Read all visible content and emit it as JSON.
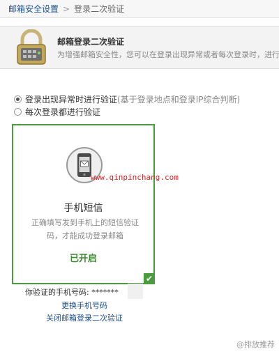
{
  "breadcrumb": {
    "parent": "邮箱安全设置",
    "separator": ">",
    "current": "登录二次验证"
  },
  "info": {
    "title": "邮箱登录二次验证",
    "description": "为增强邮箱安全性，您可以在登录出现异常或者每次登录时，进行额"
  },
  "options": {
    "opt1_label": "登录出现异常时进行验证",
    "opt1_hint": "(基于登录地点和登录IP综合判断)",
    "opt1_checked": true,
    "opt2_label": "每次登录都进行验证",
    "opt2_checked": false
  },
  "card": {
    "title": "手机短信",
    "description": "正确填写发到手机上的短信验证码，才能成功登录邮箱",
    "status": "已开启",
    "check": "✔",
    "icon": "phone-sms-icon"
  },
  "watermark": "www.qinpinchang.com",
  "phone": {
    "label": "你验证的手机号码: *******"
  },
  "links": {
    "change_phone": "更换手机号码",
    "close_verify": "关闭邮箱登录二次验证"
  },
  "brand": "@排放推荐",
  "colors": {
    "accent_green": "#4b9c3e",
    "link_blue": "#1d4f8f",
    "watermark_red": "#e02020"
  }
}
